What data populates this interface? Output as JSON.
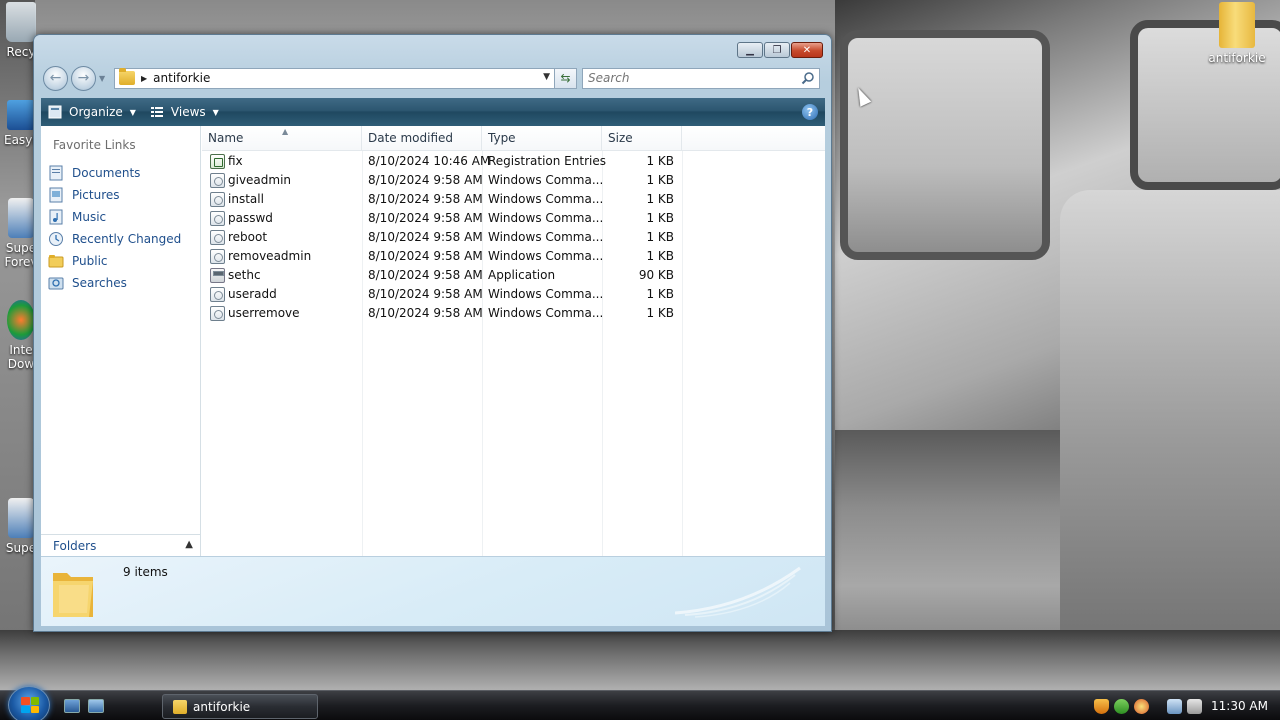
{
  "desktop": {
    "icons": [
      {
        "name": "desktop-icon-recycle-bin",
        "label": "Recy"
      },
      {
        "name": "desktop-icon-easyb",
        "label": "EasyB"
      },
      {
        "name": "desktop-icon-super-forev",
        "label": "Supe\nForev"
      },
      {
        "name": "desktop-icon-internet-dow",
        "label": "Inte\nDow"
      },
      {
        "name": "desktop-icon-super",
        "label": "Supe"
      }
    ],
    "folder_icon_label": "antiforkie"
  },
  "window": {
    "address": {
      "path": "antiforkie"
    },
    "search": {
      "placeholder": "Search"
    },
    "toolbar": {
      "organize_label": "Organize",
      "views_label": "Views"
    },
    "nav_pane": {
      "title": "Favorite Links",
      "items": [
        {
          "label": "Documents",
          "icon": "documents-icon"
        },
        {
          "label": "Pictures",
          "icon": "pictures-icon"
        },
        {
          "label": "Music",
          "icon": "music-icon"
        },
        {
          "label": "Recently Changed",
          "icon": "recently-changed-icon"
        },
        {
          "label": "Public",
          "icon": "public-folder-icon"
        },
        {
          "label": "Searches",
          "icon": "searches-icon"
        }
      ],
      "folders_label": "Folders"
    },
    "columns": [
      "Name",
      "Date modified",
      "Type",
      "Size"
    ],
    "files": [
      {
        "name": "fix",
        "date": "8/10/2024 10:46 AM",
        "type": "Registration Entries",
        "size": "1 KB",
        "icon": "reg"
      },
      {
        "name": "giveadmin",
        "date": "8/10/2024 9:58 AM",
        "type": "Windows Comma...",
        "size": "1 KB",
        "icon": "cmd"
      },
      {
        "name": "install",
        "date": "8/10/2024 9:58 AM",
        "type": "Windows Comma...",
        "size": "1 KB",
        "icon": "cmd"
      },
      {
        "name": "passwd",
        "date": "8/10/2024 9:58 AM",
        "type": "Windows Comma...",
        "size": "1 KB",
        "icon": "cmd"
      },
      {
        "name": "reboot",
        "date": "8/10/2024 9:58 AM",
        "type": "Windows Comma...",
        "size": "1 KB",
        "icon": "cmd"
      },
      {
        "name": "removeadmin",
        "date": "8/10/2024 9:58 AM",
        "type": "Windows Comma...",
        "size": "1 KB",
        "icon": "cmd"
      },
      {
        "name": "sethc",
        "date": "8/10/2024 9:58 AM",
        "type": "Application",
        "size": "90 KB",
        "icon": "app"
      },
      {
        "name": "useradd",
        "date": "8/10/2024 9:58 AM",
        "type": "Windows Comma...",
        "size": "1 KB",
        "icon": "cmd"
      },
      {
        "name": "userremove",
        "date": "8/10/2024 9:58 AM",
        "type": "Windows Comma...",
        "size": "1 KB",
        "icon": "cmd"
      }
    ],
    "details": {
      "item_count": "9 items"
    }
  },
  "taskbar": {
    "task_label": "antiforkie",
    "clock": "11:30 AM"
  },
  "colors": {
    "link": "#1f4f8c",
    "toolbar": "#2c5670",
    "taskbar": "#1c1d21"
  }
}
